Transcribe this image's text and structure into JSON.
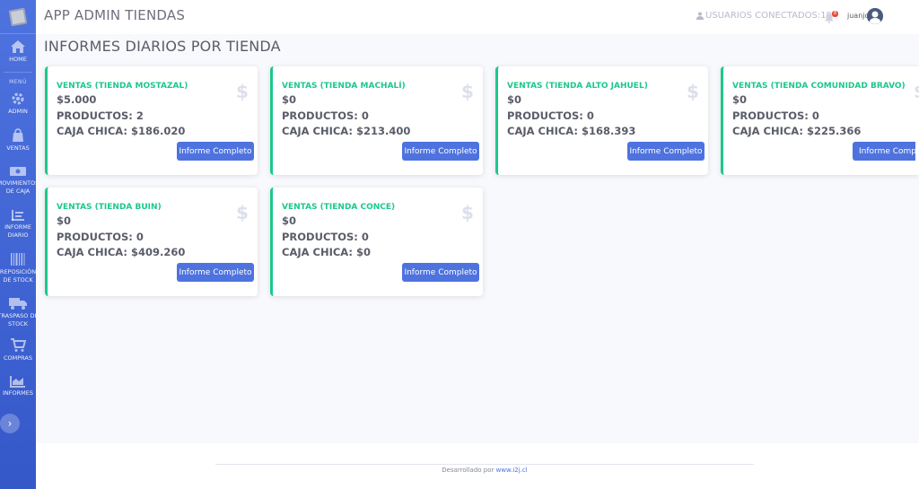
{
  "colors": {
    "sidebar": "#4e73df",
    "success": "#1cc88a",
    "primary": "#4e73df",
    "text": "#5a5c69"
  },
  "sidebar": {
    "menu_heading": "MENÚ",
    "items": [
      {
        "label": "HOME",
        "icon": "home-icon"
      },
      {
        "label": "ADMIN",
        "icon": "gear-icon"
      },
      {
        "label": "VENTAS",
        "icon": "shopping-bag-icon"
      },
      {
        "label_line1": "MOVIMIENTOS",
        "label_line2": "DE CAJA",
        "icon": "money-bill-icon"
      },
      {
        "label_line1": "INFORME",
        "label_line2": "DIARIO",
        "icon": "list-icon"
      },
      {
        "label_line1": "REPOSICIÓN",
        "label_line2": "DE STOCK",
        "icon": "barcode-icon"
      },
      {
        "label_line1": "TRASPASO DE",
        "label_line2": "STOCK",
        "icon": "truck-icon"
      },
      {
        "label": "COMPRAS",
        "icon": "cart-icon"
      },
      {
        "label": "INFORMES",
        "icon": "chart-icon"
      }
    ]
  },
  "topbar": {
    "title": "APP ADMIN TIENDAS",
    "connected_label": "USUARIOS CONECTADOS:19",
    "alert_count": "8",
    "username": "juanjo"
  },
  "page": {
    "title": "INFORMES DIARIOS POR TIENDA"
  },
  "cards": [
    {
      "title": "VENTAS (TIENDA MOSTAZAL)",
      "ventas": "$5.000",
      "productos": "PRODUCTOS: 2",
      "caja": "CAJA CHICA: $186.020",
      "button": "Informe Completo"
    },
    {
      "title": "VENTAS (TIENDA MACHALÍ)",
      "ventas": "$0",
      "productos": "PRODUCTOS: 0",
      "caja": "CAJA CHICA: $213.400",
      "button": "Informe Completo"
    },
    {
      "title": "VENTAS (TIENDA ALTO JAHUEL)",
      "ventas": "$0",
      "productos": "PRODUCTOS: 0",
      "caja": "CAJA CHICA: $168.393",
      "button": "Informe Completo"
    },
    {
      "title": "VENTAS (TIENDA COMUNIDAD BRAVO)",
      "ventas": "$0",
      "productos": "PRODUCTOS: 0",
      "caja": "CAJA CHICA: $225.366",
      "button": "Informe Completo"
    },
    {
      "title": "VENTAS (TIENDA BUIN)",
      "ventas": "$0",
      "productos": "PRODUCTOS: 0",
      "caja": "CAJA CHICA: $409.260",
      "button": "Informe Completo"
    },
    {
      "title": "VENTAS (TIENDA CONCE)",
      "ventas": "$0",
      "productos": "PRODUCTOS: 0",
      "caja": "CAJA CHICA: $0",
      "button": "Informe Completo"
    }
  ],
  "card_icon": "$",
  "footer": {
    "text": "Desarrollado por ",
    "link": "www.i2j.cl"
  }
}
